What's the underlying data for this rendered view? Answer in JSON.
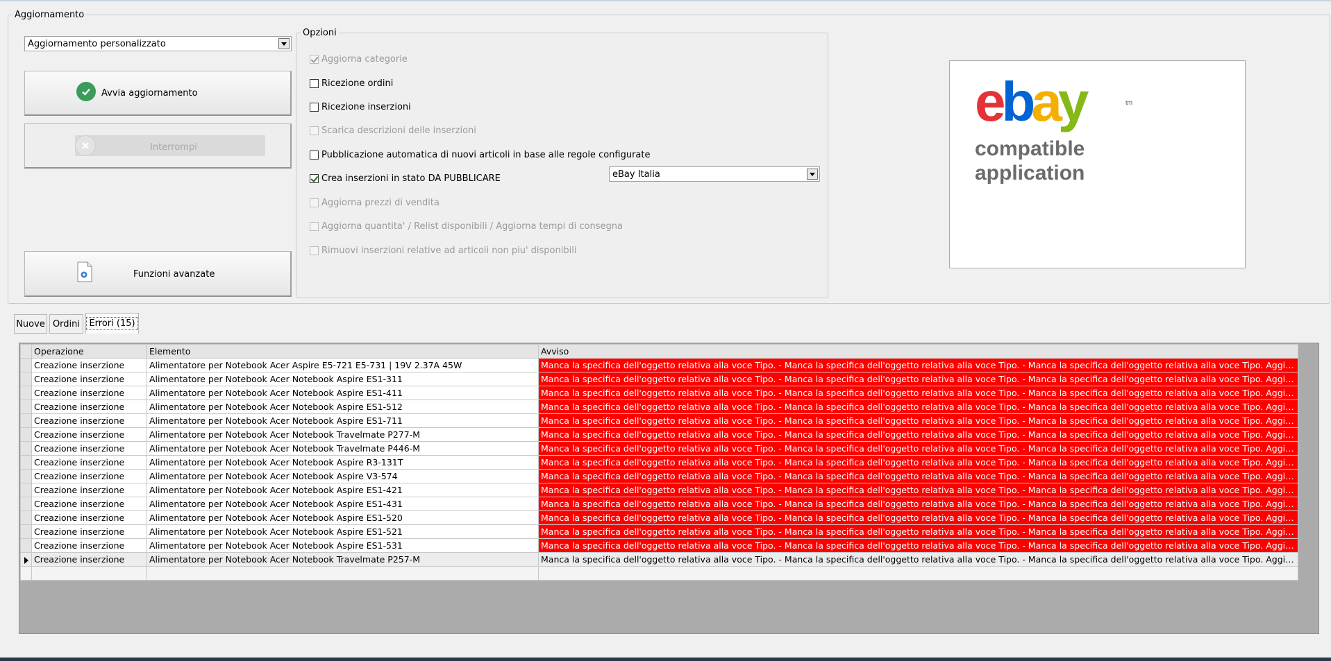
{
  "groups": {
    "aggiornamento_title": "Aggiornamento",
    "opzioni_title": "Opzioni"
  },
  "mode_select": {
    "value": "Aggiornamento personalizzato"
  },
  "buttons": {
    "avvia": "Avvia aggiornamento",
    "interrompi": "Interrompi",
    "funzioni": "Funzioni avanzate"
  },
  "options": [
    {
      "label": "Aggiorna categorie",
      "checked": true,
      "enabled": false
    },
    {
      "label": "Ricezione ordini",
      "checked": false,
      "enabled": true
    },
    {
      "label": "Ricezione inserzioni",
      "checked": false,
      "enabled": true
    },
    {
      "label": "Scarica descrizioni delle inserzioni",
      "checked": false,
      "enabled": false
    },
    {
      "label": "Pubblicazione automatica di nuovi articoli in base alle regole configurate",
      "checked": false,
      "enabled": true
    },
    {
      "label": "Crea inserzioni in stato DA PUBBLICARE",
      "checked": true,
      "enabled": true
    },
    {
      "label": "Aggiorna prezzi di vendita",
      "checked": false,
      "enabled": false
    },
    {
      "label": "Aggiorna quantita' / Relist disponibili / Aggiorna tempi di consegna",
      "checked": false,
      "enabled": false
    },
    {
      "label": "Rimuovi inserzioni relative ad articoli non piu' disponibili",
      "checked": false,
      "enabled": false
    }
  ],
  "site_select": {
    "value": "eBay Italia"
  },
  "logo": {
    "brand": "ebay",
    "tm": "tm",
    "line1": "compatible",
    "line2": "application",
    "colors": {
      "e": "#e53238",
      "b": "#0064d2",
      "a": "#f5af02",
      "y": "#86b817"
    }
  },
  "tabs": [
    {
      "label": "Nuove",
      "active": false
    },
    {
      "label": "Ordini",
      "active": false
    },
    {
      "label": "Errori (15)",
      "active": true
    }
  ],
  "grid": {
    "columns": [
      "Operazione",
      "Elemento",
      "Avviso"
    ],
    "error_color": "#ff0000",
    "rows": [
      {
        "op": "Creazione inserzione",
        "el": "Alimentatore per Notebook Acer Aspire E5-721 E5-731  | 19V 2.37A 45W",
        "msg": "Manca la specifica dell'oggetto relativa alla voce Tipo. - Manca la specifica dell'oggetto relativa alla voce Tipo. - Manca la specifica dell'oggetto relativa alla voce Tipo. Aggiungi la vo...",
        "error": true
      },
      {
        "op": "Creazione inserzione",
        "el": "Alimentatore per Notebook Acer Notebook Aspire ES1-311",
        "msg": "Manca la specifica dell'oggetto relativa alla voce Tipo. - Manca la specifica dell'oggetto relativa alla voce Tipo. - Manca la specifica dell'oggetto relativa alla voce Tipo. Aggiungi la vo...",
        "error": true
      },
      {
        "op": "Creazione inserzione",
        "el": "Alimentatore per Notebook Acer Notebook Aspire ES1-411",
        "msg": "Manca la specifica dell'oggetto relativa alla voce Tipo. - Manca la specifica dell'oggetto relativa alla voce Tipo. - Manca la specifica dell'oggetto relativa alla voce Tipo. Aggiungi la vo...",
        "error": true
      },
      {
        "op": "Creazione inserzione",
        "el": "Alimentatore per Notebook Acer Notebook Aspire ES1-512",
        "msg": "Manca la specifica dell'oggetto relativa alla voce Tipo. - Manca la specifica dell'oggetto relativa alla voce Tipo. - Manca la specifica dell'oggetto relativa alla voce Tipo. Aggiungi la vo...",
        "error": true
      },
      {
        "op": "Creazione inserzione",
        "el": "Alimentatore per Notebook Acer Notebook Aspire ES1-711",
        "msg": "Manca la specifica dell'oggetto relativa alla voce Tipo. - Manca la specifica dell'oggetto relativa alla voce Tipo. - Manca la specifica dell'oggetto relativa alla voce Tipo. Aggiungi la vo...",
        "error": true
      },
      {
        "op": "Creazione inserzione",
        "el": "Alimentatore per Notebook Acer Notebook Travelmate P277-M",
        "msg": "Manca la specifica dell'oggetto relativa alla voce Tipo. - Manca la specifica dell'oggetto relativa alla voce Tipo. - Manca la specifica dell'oggetto relativa alla voce Tipo. Aggiungi la vo...",
        "error": true
      },
      {
        "op": "Creazione inserzione",
        "el": "Alimentatore per Notebook Acer Notebook Travelmate P446-M",
        "msg": "Manca la specifica dell'oggetto relativa alla voce Tipo. - Manca la specifica dell'oggetto relativa alla voce Tipo. - Manca la specifica dell'oggetto relativa alla voce Tipo. Aggiungi la vo...",
        "error": true
      },
      {
        "op": "Creazione inserzione",
        "el": "Alimentatore per Notebook Acer Notebook Aspire R3-131T",
        "msg": "Manca la specifica dell'oggetto relativa alla voce Tipo. - Manca la specifica dell'oggetto relativa alla voce Tipo. - Manca la specifica dell'oggetto relativa alla voce Tipo. Aggiungi la vo...",
        "error": true
      },
      {
        "op": "Creazione inserzione",
        "el": "Alimentatore per Notebook Acer Notebook Aspire V3-574",
        "msg": "Manca la specifica dell'oggetto relativa alla voce Tipo. - Manca la specifica dell'oggetto relativa alla voce Tipo. - Manca la specifica dell'oggetto relativa alla voce Tipo. Aggiungi la vo...",
        "error": true
      },
      {
        "op": "Creazione inserzione",
        "el": "Alimentatore per Notebook Acer Notebook Aspire ES1-421",
        "msg": "Manca la specifica dell'oggetto relativa alla voce Tipo. - Manca la specifica dell'oggetto relativa alla voce Tipo. - Manca la specifica dell'oggetto relativa alla voce Tipo. Aggiungi la vo...",
        "error": true
      },
      {
        "op": "Creazione inserzione",
        "el": "Alimentatore per Notebook Acer Notebook Aspire ES1-431",
        "msg": "Manca la specifica dell'oggetto relativa alla voce Tipo. - Manca la specifica dell'oggetto relativa alla voce Tipo. - Manca la specifica dell'oggetto relativa alla voce Tipo. Aggiungi la vo...",
        "error": true
      },
      {
        "op": "Creazione inserzione",
        "el": "Alimentatore per Notebook Acer Notebook Aspire ES1-520",
        "msg": "Manca la specifica dell'oggetto relativa alla voce Tipo. - Manca la specifica dell'oggetto relativa alla voce Tipo. - Manca la specifica dell'oggetto relativa alla voce Tipo. Aggiungi la vo...",
        "error": true
      },
      {
        "op": "Creazione inserzione",
        "el": "Alimentatore per Notebook Acer Notebook Aspire ES1-521",
        "msg": "Manca la specifica dell'oggetto relativa alla voce Tipo. - Manca la specifica dell'oggetto relativa alla voce Tipo. - Manca la specifica dell'oggetto relativa alla voce Tipo. Aggiungi la vo...",
        "error": true
      },
      {
        "op": "Creazione inserzione",
        "el": "Alimentatore per Notebook Acer Notebook Aspire ES1-531",
        "msg": "Manca la specifica dell'oggetto relativa alla voce Tipo. - Manca la specifica dell'oggetto relativa alla voce Tipo. - Manca la specifica dell'oggetto relativa alla voce Tipo. Aggiungi la vo...",
        "error": true
      },
      {
        "op": "Creazione inserzione",
        "el": "Alimentatore per Notebook Acer Notebook Travelmate P257-M",
        "msg": "Manca la specifica dell'oggetto relativa alla voce Tipo. - Manca la specifica dell'oggetto relativa alla voce Tipo. - Manca la specifica dell'oggetto relativa alla voce Tipo. Aggiungi la vo...",
        "error": false,
        "selected": true
      }
    ]
  }
}
